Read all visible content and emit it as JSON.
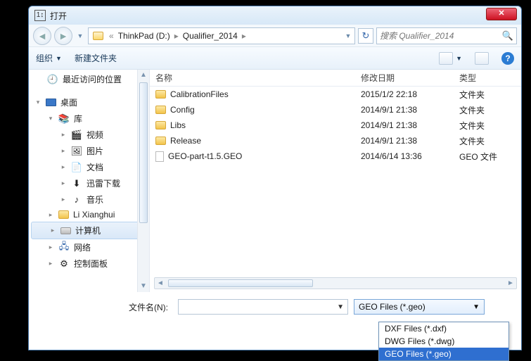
{
  "titlebar": {
    "title": "打开"
  },
  "breadcrumbs": {
    "prefix_glyph": "«",
    "items": [
      "ThinkPad (D:)",
      "Qualifier_2014"
    ]
  },
  "search": {
    "placeholder": "搜索 Qualifier_2014"
  },
  "toolbar": {
    "organize": "组织",
    "new_folder": "新建文件夹"
  },
  "sidebar": {
    "recent": "最近访问的位置",
    "desktop": "桌面",
    "library": "库",
    "videos": "视频",
    "pictures": "图片",
    "documents": "文档",
    "xunlei": "迅雷下载",
    "music": "音乐",
    "user": "Li Xianghui",
    "computer": "计算机",
    "network": "网络",
    "control_panel": "控制面板"
  },
  "columns": {
    "name": "名称",
    "date": "修改日期",
    "type": "类型"
  },
  "files": [
    {
      "name": "CalibrationFiles",
      "date": "2015/1/2 22:18",
      "type": "文件夹",
      "kind": "folder"
    },
    {
      "name": "Config",
      "date": "2014/9/1 21:38",
      "type": "文件夹",
      "kind": "folder"
    },
    {
      "name": "Libs",
      "date": "2014/9/1 21:38",
      "type": "文件夹",
      "kind": "folder"
    },
    {
      "name": "Release",
      "date": "2014/9/1 21:38",
      "type": "文件夹",
      "kind": "folder"
    },
    {
      "name": "GEO-part-t1.5.GEO",
      "date": "2014/6/14 13:36",
      "type": "GEO 文件",
      "kind": "file"
    }
  ],
  "footer": {
    "filename_label": "文件名(N):",
    "filename_value": "",
    "type_selected": "GEO Files (*.geo)",
    "type_options": [
      "DXF Files (*.dxf)",
      "DWG Files (*.dwg)",
      "GEO Files (*.geo)"
    ]
  }
}
